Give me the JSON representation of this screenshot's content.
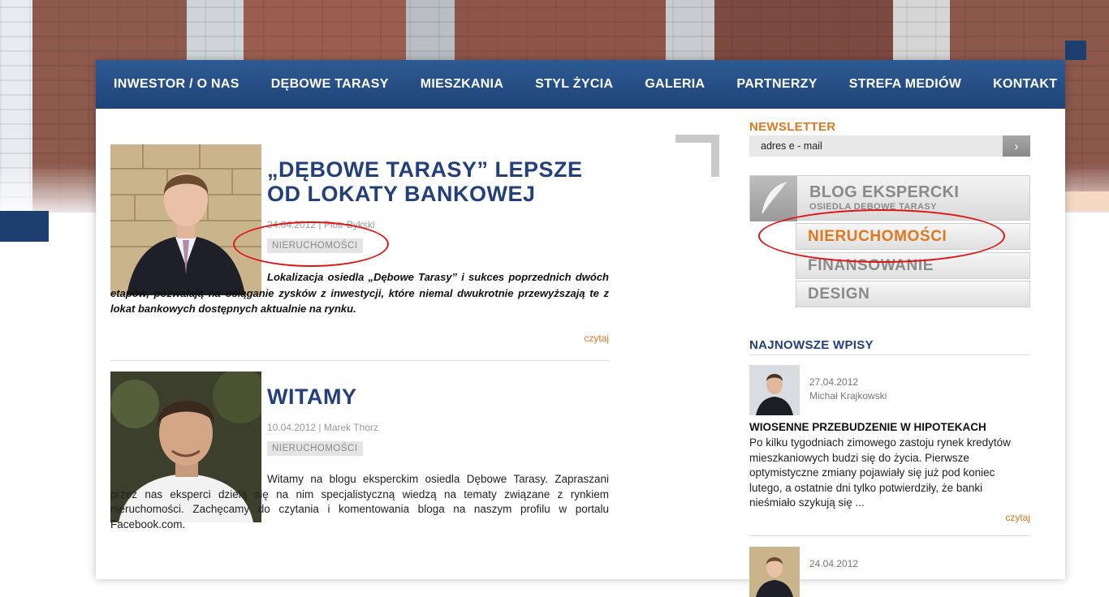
{
  "nav": {
    "items": [
      "INWESTOR / O NAS",
      "DĘBOWE TARASY",
      "MIESZKANIA",
      "STYL ŻYCIA",
      "GALERIA",
      "PARTNERZY",
      "STREFA MEDIÓW",
      "KONTAKT"
    ]
  },
  "posts": [
    {
      "title_line1": "„DĘBOWE TARASY” LEPSZE",
      "title_line2": "OD LOKATY BANKOWEJ",
      "meta": "24.04.2012 | Piotr Bykski",
      "tag": "NIERUCHOMOŚCI",
      "body": "Lokalizacja osiedla „Dębowe Tarasy” i sukces poprzednich dwóch etapów, pozwalają na osiąganie zysków z inwestycji, które niemal dwukrotnie przewyższają te z lokat bankowych dostępnych aktualnie na rynku.",
      "read_more": "czytaj"
    },
    {
      "title_line1": "WITAMY",
      "meta": "10.04.2012 | Marek Thorz",
      "tag": "NIERUCHOMOŚCI",
      "body": "Witamy na blogu eksperckim osiedla Dębowe Tarasy. Zapraszani przez nas eksperci dzielą się na nim specjalistyczną wiedzą na tematy związane z rynkiem nieruchomości. Zachęcamy do czytania i komentowania bloga na naszym profilu w portalu Facebook.com."
    }
  ],
  "sidebar": {
    "newsletter_heading": "NEWSLETTER",
    "newsletter_placeholder": "adres e - mail",
    "blog_title": "BLOG EKSPERCKI",
    "blog_subtitle": "OSIEDLA DĘBOWE TARASY",
    "categories": [
      "NIERUCHOMOŚCI",
      "FINANSOWANIE",
      "DESIGN"
    ],
    "latest_heading": "NAJNOWSZE WPISY",
    "latest": [
      {
        "date": "27.04.2012",
        "author": "Michał Krajkowski",
        "title": "WIOSENNE PRZEBUDZENIE W HIPOTEKACH",
        "text": "Po kilku tygodniach zimowego zastoju rynek kredytów mieszkaniowych budzi się do życia. Pierwsze optymistyczne zmiany pojawiały się już pod koniec lutego, a ostatnie dni tylko potwierdziły, że banki nieśmiało szykują się ...",
        "read_more": "czytaj"
      },
      {
        "date": "24.04.2012"
      }
    ]
  },
  "colors": {
    "nav_blue": "#23487f",
    "title_blue": "#23407a",
    "accent_orange": "#e07820",
    "annotation_red": "#e01414"
  }
}
